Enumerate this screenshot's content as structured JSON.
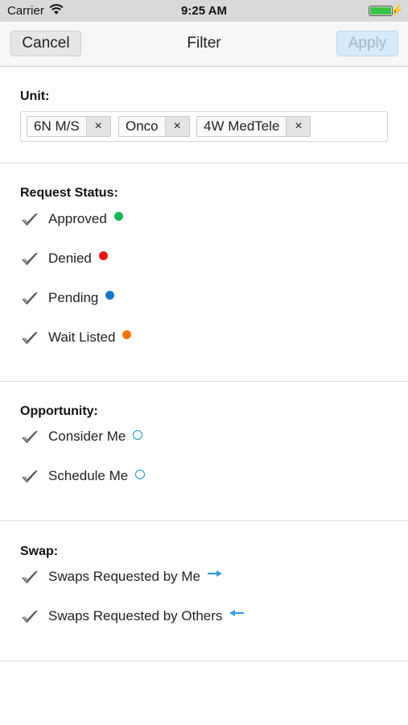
{
  "status_bar": {
    "carrier": "Carrier",
    "time": "9:25 AM",
    "battery_level": 1.0,
    "charging_icon": "bolt-icon"
  },
  "nav": {
    "cancel_label": "Cancel",
    "title": "Filter",
    "apply_label": "Apply"
  },
  "unit": {
    "title": "Unit:",
    "chips": [
      {
        "label": "6N M/S",
        "remove": "×"
      },
      {
        "label": "Onco",
        "remove": "×"
      },
      {
        "label": "4W MedTele",
        "remove": "×"
      }
    ]
  },
  "request_status": {
    "title": "Request Status:",
    "items": [
      {
        "label": "Approved",
        "color": "#19b359",
        "checked": true
      },
      {
        "label": "Denied",
        "color": "#e81414",
        "checked": true
      },
      {
        "label": "Pending",
        "color": "#1776c8",
        "checked": true
      },
      {
        "label": "Wait Listed",
        "color": "#f2720c",
        "checked": true
      }
    ]
  },
  "opportunity": {
    "title": "Opportunity:",
    "items": [
      {
        "label": "Consider Me",
        "icon": "circle-outline-icon",
        "checked": true
      },
      {
        "label": "Schedule Me",
        "icon": "circle-outline-icon",
        "checked": true
      }
    ]
  },
  "swap": {
    "title": "Swap:",
    "items": [
      {
        "label": "Swaps Requested by Me",
        "icon": "arrow-right-icon",
        "checked": true
      },
      {
        "label": "Swaps Requested by Others",
        "icon": "arrow-left-icon",
        "checked": true
      }
    ]
  },
  "colors": {
    "accent": "#1a8fd1",
    "apply_disabled_bg": "#d6eaf8",
    "arrow": "#3a98e0"
  }
}
